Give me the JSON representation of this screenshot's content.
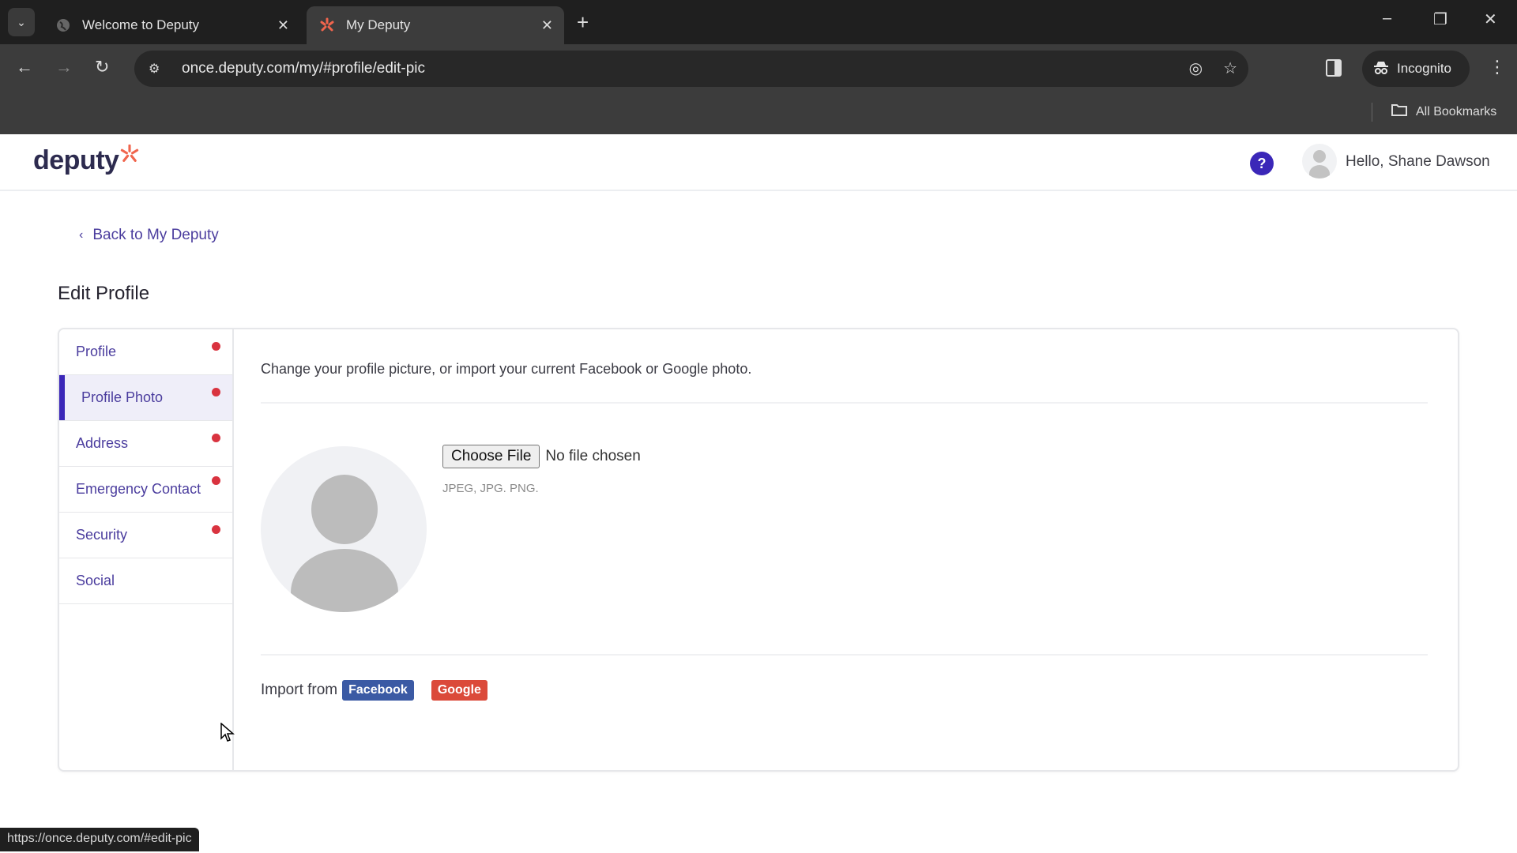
{
  "browser": {
    "tabs": [
      {
        "title": "Welcome to Deputy",
        "favicon": "globe-icon",
        "active": false
      },
      {
        "title": "My Deputy",
        "favicon": "deputy-star-icon",
        "active": true
      }
    ],
    "url": "once.deputy.com/my/#profile/edit-pic",
    "incognito_label": "Incognito",
    "bookmarks_label": "All Bookmarks",
    "status_url": "https://once.deputy.com/#edit-pic"
  },
  "header": {
    "logo_text": "deputy",
    "help_label": "?",
    "greeting": "Hello, Shane Dawson"
  },
  "page": {
    "back_link": "Back to My Deputy",
    "title": "Edit Profile"
  },
  "sidebar": {
    "items": [
      {
        "label": "Profile",
        "incomplete": true,
        "active": false
      },
      {
        "label": "Profile Photo",
        "incomplete": true,
        "active": true
      },
      {
        "label": "Address",
        "incomplete": true,
        "active": false
      },
      {
        "label": "Emergency Contact",
        "incomplete": true,
        "active": false
      },
      {
        "label": "Security",
        "incomplete": true,
        "active": false
      },
      {
        "label": "Social",
        "incomplete": false,
        "active": false
      }
    ]
  },
  "content": {
    "description": "Change your profile picture, or import your current Facebook or Google photo.",
    "choose_file_label": "Choose File",
    "file_status": "No file chosen",
    "file_hint": "JPEG, JPG. PNG.",
    "import_label": "Import from",
    "facebook_label": "Facebook",
    "google_label": "Google"
  },
  "colors": {
    "brand_purple": "#3b27b8",
    "link_purple": "#4b3d9e",
    "logo_accent": "#f0654d",
    "incomplete_dot": "#d9333f",
    "facebook_blue": "#3b5aa4",
    "google_red": "#db4a3a"
  }
}
